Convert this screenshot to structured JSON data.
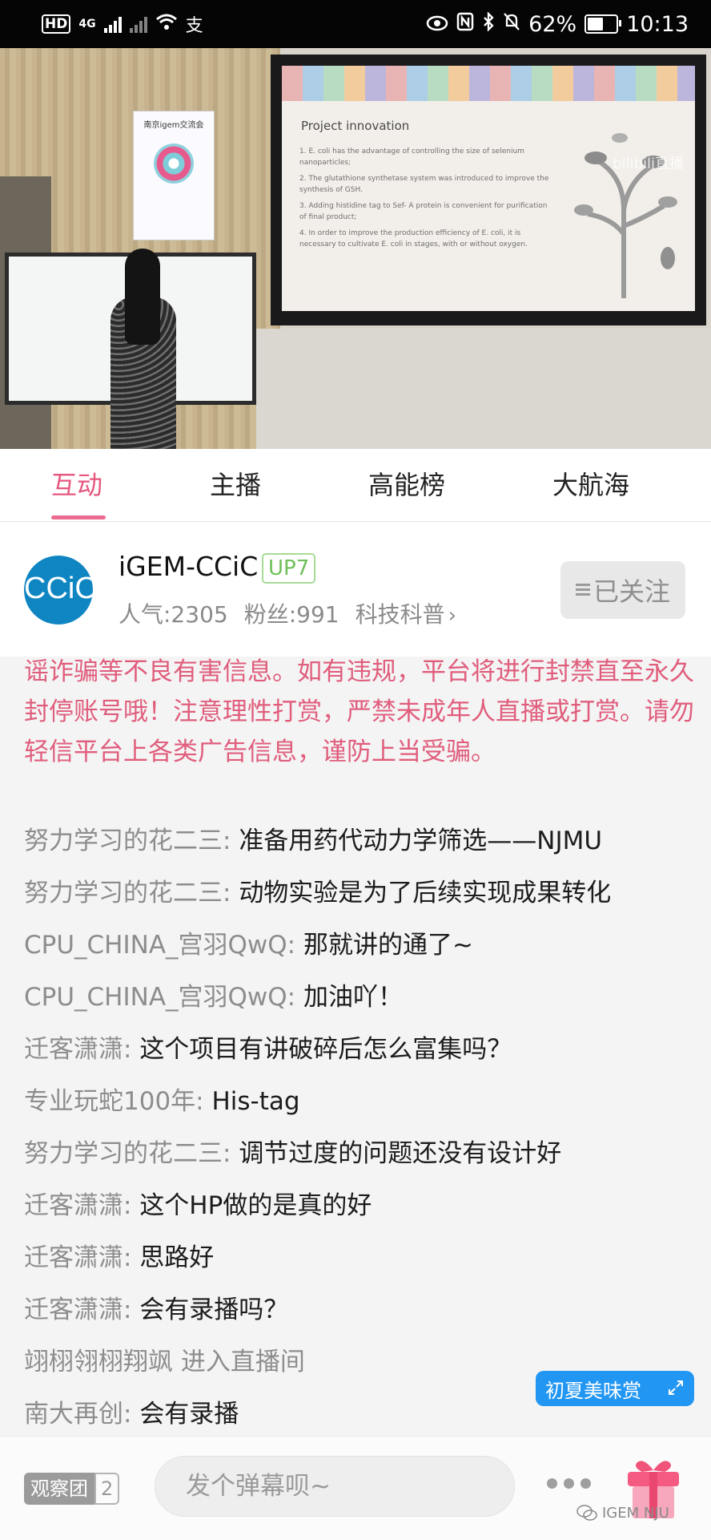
{
  "status_bar": {
    "network": "4G",
    "hd": "HD",
    "battery": "62%",
    "battery_level": 0.62,
    "time": "10:13"
  },
  "slide": {
    "title": "Project innovation",
    "lines": [
      "1. E. coli has the advantage of controlling the size of selenium nanoparticles;",
      "2. The glutathione synthetase system was introduced to improve the synthesis of GSH.",
      "3. Adding histidine tag to Sef- A protein is convenient for purification of final product;",
      "4. In order to improve the production efficiency of E. coli, it is necessary to cultivate E. coli in stages, with or without oxygen."
    ],
    "poster_title": "南京igem交流会",
    "watermark": "bilibili直播"
  },
  "tabs": [
    {
      "label": "互动",
      "active": true
    },
    {
      "label": "主播",
      "active": false
    },
    {
      "label": "高能榜",
      "active": false
    },
    {
      "label": "大航海",
      "active": false
    }
  ],
  "streamer": {
    "avatar_text": "CCiC",
    "name": "iGEM-CCiC",
    "level": "UP7",
    "popularity": "人气:2305",
    "fans": "粉丝:991",
    "category": "科技科普",
    "follow_label": "已关注"
  },
  "chat": {
    "notice": "谣诈骗等不良有害信息。如有违规，平台将进行封禁直至永久封停账号哦！注意理性打赏，严禁未成年人直播或打赏。请勿轻信平台上各类广告信息，谨防上当受骗。",
    "messages": [
      {
        "user": "努力学习的花二三:",
        "text": "准备用药代动力学筛选——NJMU"
      },
      {
        "user": "努力学习的花二三:",
        "text": "动物实验是为了后续实现成果转化"
      },
      {
        "user": "CPU_CHINA_宫羽QwQ:",
        "text": "那就讲的通了~"
      },
      {
        "user": "CPU_CHINA_宫羽QwQ:",
        "text": "加油吖！"
      },
      {
        "user": "迁客潇潇:",
        "text": "这个项目有讲破碎后怎么富集吗？"
      },
      {
        "user": "专业玩蛇100年:",
        "text": "His-tag"
      },
      {
        "user": "努力学习的花二三:",
        "text": "调节过度的问题还没有设计好"
      },
      {
        "user": "迁客潇潇:",
        "text": "这个HP做的是真的好"
      },
      {
        "user": "迁客潇潇:",
        "text": "思路好"
      },
      {
        "user": "迁客潇潇:",
        "text": "会有录播吗？"
      },
      {
        "user": "翊栩翎栩翔飒 进入直播间",
        "text": ""
      },
      {
        "user": "南大再创:",
        "text": "会有录播"
      }
    ],
    "promo_label": "初夏美味赏"
  },
  "bottom_bar": {
    "observe_label": "观察团",
    "observe_count": "2",
    "danmu_placeholder": "发个弹幕呗~",
    "watermark": "IGEM NJU"
  },
  "colors": {
    "accent": "#e5577d",
    "notice": "#e05d7c",
    "promo": "#2196f3",
    "up_badge": "#6fbf5a"
  }
}
